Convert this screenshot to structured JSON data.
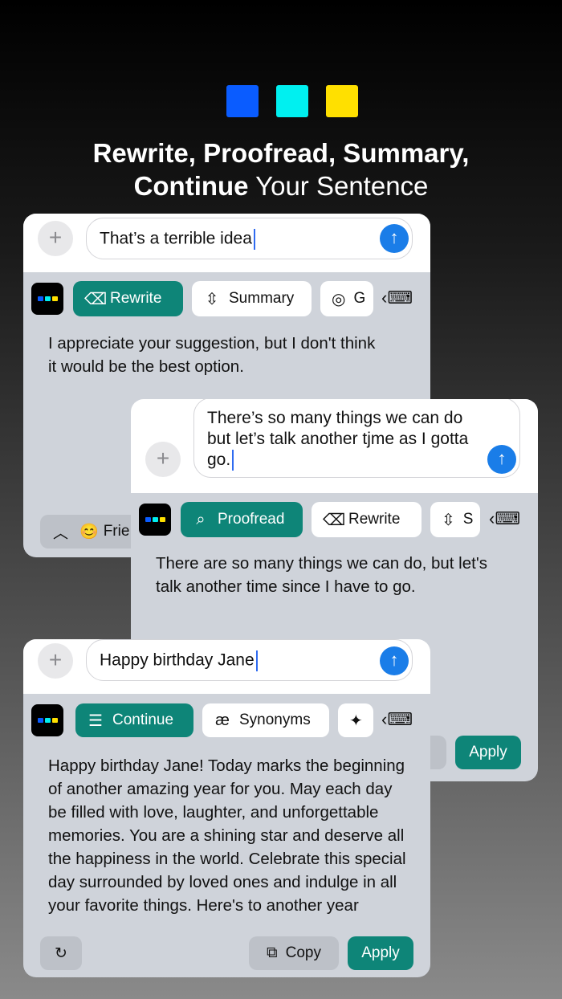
{
  "header": {
    "colors": [
      "#0a5cff",
      "#00f0f0",
      "#ffe000"
    ],
    "line1_bold": "Rewrite, Proofread, Summary,",
    "line2_bold": "Continue",
    "line2_light": " Your Sentence"
  },
  "card1": {
    "input": "That’s a terrible idea",
    "chips": [
      {
        "icon": "eraser-icon",
        "label": "Rewrite",
        "active": true
      },
      {
        "icon": "compress-icon",
        "label": "Summary",
        "active": false
      },
      {
        "icon": "brain-icon",
        "label": "G",
        "active": false
      }
    ],
    "result": "I appreciate your suggestion, but I don't think it would be the best option.",
    "tone_label": "Frie",
    "tone_emoji": "😊"
  },
  "card2": {
    "input": "There’s so many things we can do but let’s talk another tjme as I gotta go.",
    "chips": [
      {
        "icon": "search-icon",
        "label": "Proofread",
        "active": true
      },
      {
        "icon": "eraser-icon",
        "label": "Rewrite",
        "active": false
      },
      {
        "icon": "compress-icon",
        "label": "S",
        "active": false
      }
    ],
    "result": "There are so many things we can do, but let's talk another time since I have to go.",
    "apply_label": "Apply"
  },
  "card3": {
    "input": "Happy birthday Jane",
    "chips": [
      {
        "icon": "continue-icon",
        "label": "Continue",
        "active": true
      },
      {
        "icon": "ae-icon",
        "label": "Synonyms",
        "active": false
      },
      {
        "icon": "sparkle-icon",
        "label": "",
        "active": false
      }
    ],
    "result": "Happy birthday Jane! Today marks the beginning of another amazing year for you. May each day be filled with love, laughter, and unforgettable memories. You are a shining star and deserve all the happiness in the world. Celebrate this special day surrounded by loved ones and indulge in all your favorite things. Here's to another year",
    "copy_label": "Copy",
    "apply_label": "Apply"
  }
}
